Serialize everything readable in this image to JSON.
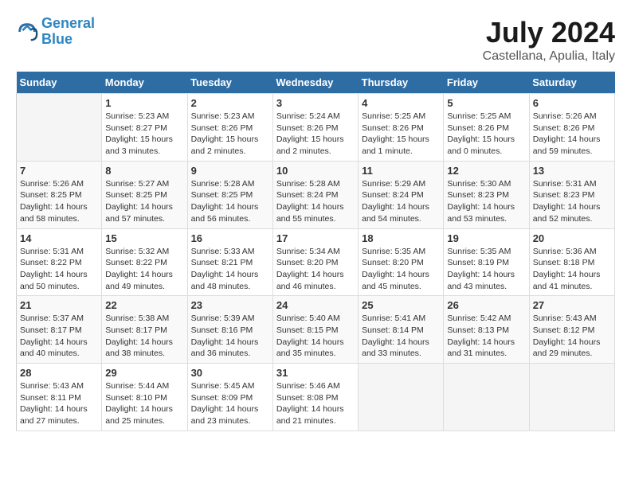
{
  "header": {
    "logo_line1": "General",
    "logo_line2": "Blue",
    "month_year": "July 2024",
    "location": "Castellana, Apulia, Italy"
  },
  "weekdays": [
    "Sunday",
    "Monday",
    "Tuesday",
    "Wednesday",
    "Thursday",
    "Friday",
    "Saturday"
  ],
  "weeks": [
    [
      {
        "day": "",
        "content": ""
      },
      {
        "day": "1",
        "content": "Sunrise: 5:23 AM\nSunset: 8:27 PM\nDaylight: 15 hours\nand 3 minutes."
      },
      {
        "day": "2",
        "content": "Sunrise: 5:23 AM\nSunset: 8:26 PM\nDaylight: 15 hours\nand 2 minutes."
      },
      {
        "day": "3",
        "content": "Sunrise: 5:24 AM\nSunset: 8:26 PM\nDaylight: 15 hours\nand 2 minutes."
      },
      {
        "day": "4",
        "content": "Sunrise: 5:25 AM\nSunset: 8:26 PM\nDaylight: 15 hours\nand 1 minute."
      },
      {
        "day": "5",
        "content": "Sunrise: 5:25 AM\nSunset: 8:26 PM\nDaylight: 15 hours\nand 0 minutes."
      },
      {
        "day": "6",
        "content": "Sunrise: 5:26 AM\nSunset: 8:26 PM\nDaylight: 14 hours\nand 59 minutes."
      }
    ],
    [
      {
        "day": "7",
        "content": "Sunrise: 5:26 AM\nSunset: 8:25 PM\nDaylight: 14 hours\nand 58 minutes."
      },
      {
        "day": "8",
        "content": "Sunrise: 5:27 AM\nSunset: 8:25 PM\nDaylight: 14 hours\nand 57 minutes."
      },
      {
        "day": "9",
        "content": "Sunrise: 5:28 AM\nSunset: 8:25 PM\nDaylight: 14 hours\nand 56 minutes."
      },
      {
        "day": "10",
        "content": "Sunrise: 5:28 AM\nSunset: 8:24 PM\nDaylight: 14 hours\nand 55 minutes."
      },
      {
        "day": "11",
        "content": "Sunrise: 5:29 AM\nSunset: 8:24 PM\nDaylight: 14 hours\nand 54 minutes."
      },
      {
        "day": "12",
        "content": "Sunrise: 5:30 AM\nSunset: 8:23 PM\nDaylight: 14 hours\nand 53 minutes."
      },
      {
        "day": "13",
        "content": "Sunrise: 5:31 AM\nSunset: 8:23 PM\nDaylight: 14 hours\nand 52 minutes."
      }
    ],
    [
      {
        "day": "14",
        "content": "Sunrise: 5:31 AM\nSunset: 8:22 PM\nDaylight: 14 hours\nand 50 minutes."
      },
      {
        "day": "15",
        "content": "Sunrise: 5:32 AM\nSunset: 8:22 PM\nDaylight: 14 hours\nand 49 minutes."
      },
      {
        "day": "16",
        "content": "Sunrise: 5:33 AM\nSunset: 8:21 PM\nDaylight: 14 hours\nand 48 minutes."
      },
      {
        "day": "17",
        "content": "Sunrise: 5:34 AM\nSunset: 8:20 PM\nDaylight: 14 hours\nand 46 minutes."
      },
      {
        "day": "18",
        "content": "Sunrise: 5:35 AM\nSunset: 8:20 PM\nDaylight: 14 hours\nand 45 minutes."
      },
      {
        "day": "19",
        "content": "Sunrise: 5:35 AM\nSunset: 8:19 PM\nDaylight: 14 hours\nand 43 minutes."
      },
      {
        "day": "20",
        "content": "Sunrise: 5:36 AM\nSunset: 8:18 PM\nDaylight: 14 hours\nand 41 minutes."
      }
    ],
    [
      {
        "day": "21",
        "content": "Sunrise: 5:37 AM\nSunset: 8:17 PM\nDaylight: 14 hours\nand 40 minutes."
      },
      {
        "day": "22",
        "content": "Sunrise: 5:38 AM\nSunset: 8:17 PM\nDaylight: 14 hours\nand 38 minutes."
      },
      {
        "day": "23",
        "content": "Sunrise: 5:39 AM\nSunset: 8:16 PM\nDaylight: 14 hours\nand 36 minutes."
      },
      {
        "day": "24",
        "content": "Sunrise: 5:40 AM\nSunset: 8:15 PM\nDaylight: 14 hours\nand 35 minutes."
      },
      {
        "day": "25",
        "content": "Sunrise: 5:41 AM\nSunset: 8:14 PM\nDaylight: 14 hours\nand 33 minutes."
      },
      {
        "day": "26",
        "content": "Sunrise: 5:42 AM\nSunset: 8:13 PM\nDaylight: 14 hours\nand 31 minutes."
      },
      {
        "day": "27",
        "content": "Sunrise: 5:43 AM\nSunset: 8:12 PM\nDaylight: 14 hours\nand 29 minutes."
      }
    ],
    [
      {
        "day": "28",
        "content": "Sunrise: 5:43 AM\nSunset: 8:11 PM\nDaylight: 14 hours\nand 27 minutes."
      },
      {
        "day": "29",
        "content": "Sunrise: 5:44 AM\nSunset: 8:10 PM\nDaylight: 14 hours\nand 25 minutes."
      },
      {
        "day": "30",
        "content": "Sunrise: 5:45 AM\nSunset: 8:09 PM\nDaylight: 14 hours\nand 23 minutes."
      },
      {
        "day": "31",
        "content": "Sunrise: 5:46 AM\nSunset: 8:08 PM\nDaylight: 14 hours\nand 21 minutes."
      },
      {
        "day": "",
        "content": ""
      },
      {
        "day": "",
        "content": ""
      },
      {
        "day": "",
        "content": ""
      }
    ]
  ]
}
